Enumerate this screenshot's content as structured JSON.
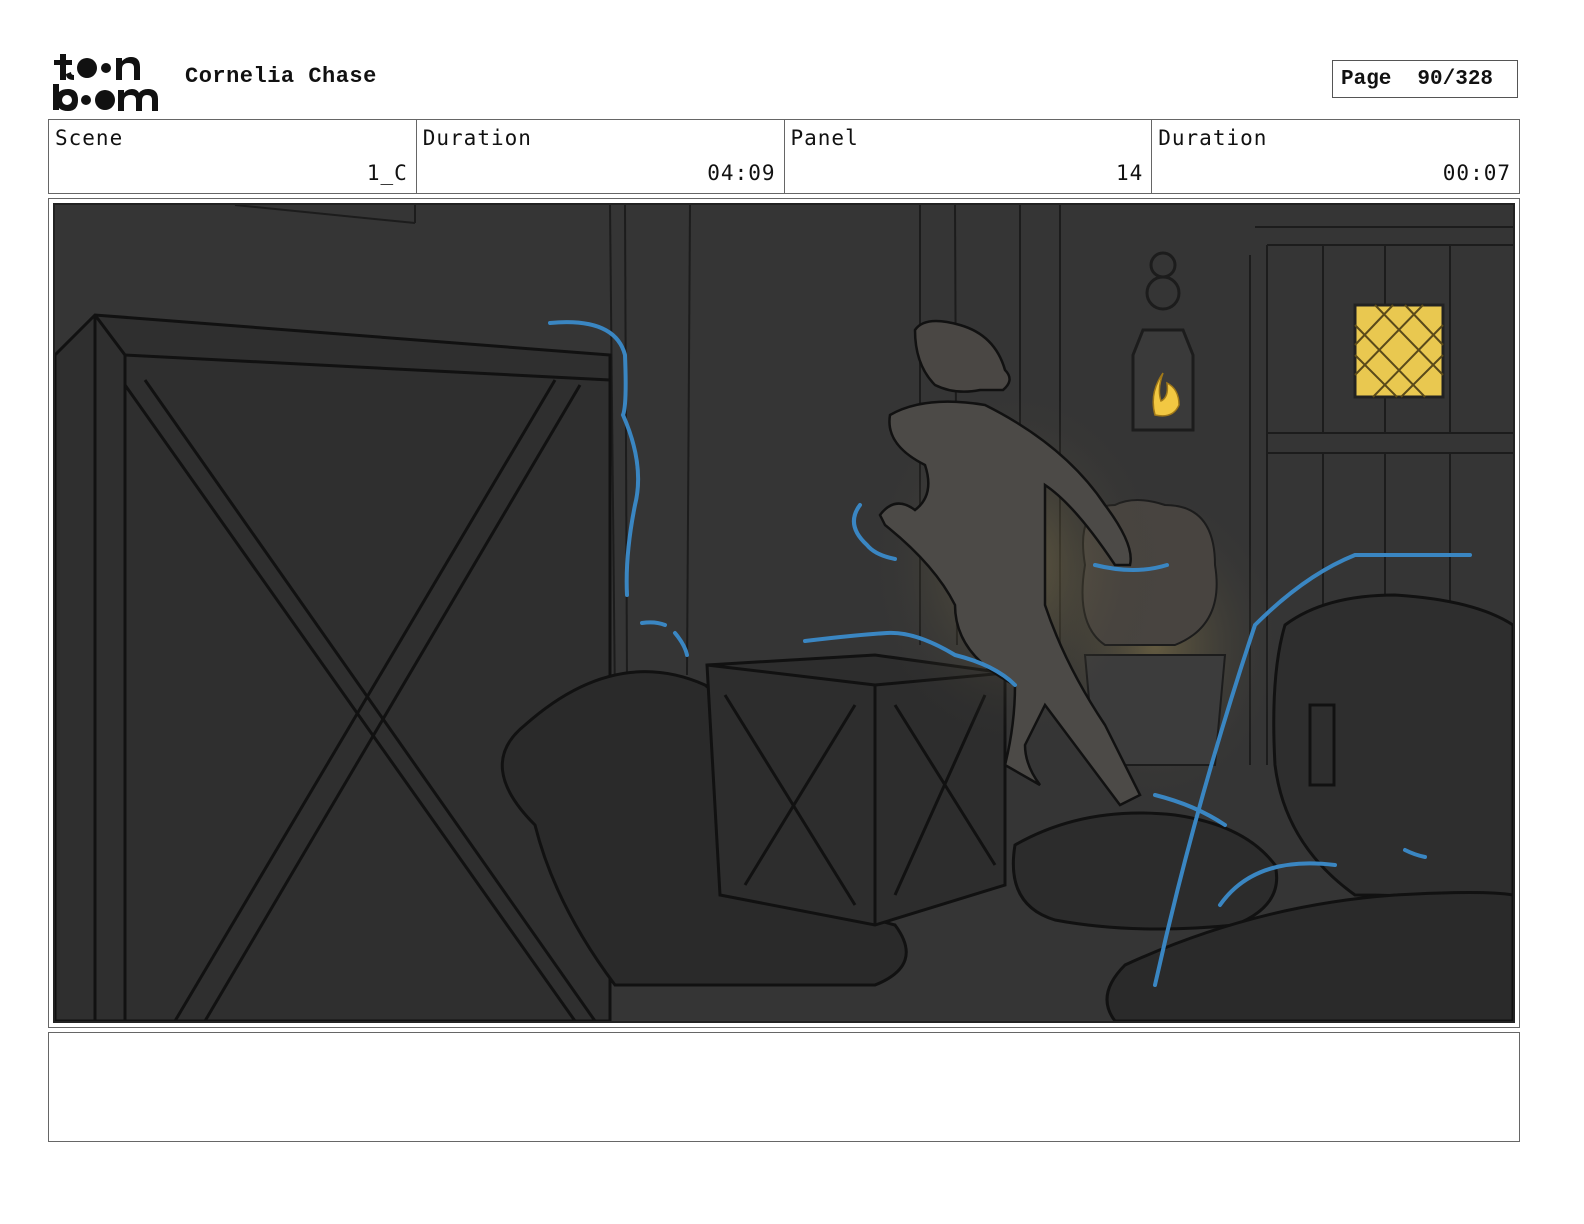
{
  "header": {
    "logo_text": "toon boom",
    "project_title": "Cornelia Chase",
    "page_label": "Page",
    "page_number": "90/328"
  },
  "info": {
    "scene_label": "Scene",
    "scene_value": "1_C",
    "scene_duration_label": "Duration",
    "scene_duration_value": "04:09",
    "panel_label": "Panel",
    "panel_value": "14",
    "panel_duration_label": "Duration",
    "panel_duration_value": "00:07"
  },
  "notes": {
    "text": ""
  },
  "colors": {
    "background_dark": "#333333",
    "sketch_line": "#111111",
    "motion_lines": "#3a86c2",
    "warm_light": "#f2d35c"
  }
}
